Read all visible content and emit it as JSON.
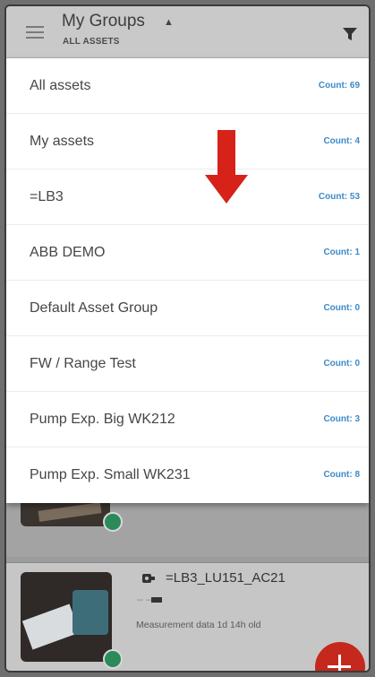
{
  "header": {
    "title": "My Groups",
    "subtitle": "ALL ASSETS",
    "caret_icon": "caret-up-icon",
    "filter_icon": "filter-icon",
    "menu_icon": "hamburger-icon"
  },
  "groups": [
    {
      "label": "All assets",
      "count": "Count: 69"
    },
    {
      "label": "My assets",
      "count": "Count: 4"
    },
    {
      "label": "=LB3",
      "count": "Count: 53"
    },
    {
      "label": "ABB DEMO",
      "count": "Count: 1"
    },
    {
      "label": "Default Asset Group",
      "count": "Count: 0"
    },
    {
      "label": "FW / Range Test",
      "count": "Count: 0"
    },
    {
      "label": "Pump Exp. Big WK212",
      "count": "Count: 3"
    },
    {
      "label": "Pump Exp. Small WK231",
      "count": "Count: 8"
    }
  ],
  "asset_card": {
    "name": "=LB3_LU151_AC21",
    "status": "– –",
    "measurement": "Measurement data 1d 14h old"
  },
  "colors": {
    "header_bg": "#c9c9c9",
    "count_text": "#3d8ac7",
    "annotation_arrow": "#d62219",
    "fab": "#c5281d",
    "status_check": "#2a8a5a"
  }
}
